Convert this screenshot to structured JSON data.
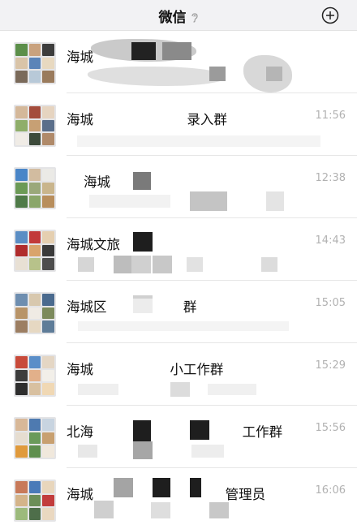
{
  "header": {
    "title": "微信",
    "muted_icon": "ear-icon",
    "add_icon": "plus-circle-icon"
  },
  "chats": [
    {
      "name": "海城",
      "time": ""
    },
    {
      "name": "海城                      录入群",
      "time": "11:56"
    },
    {
      "name": "    海城",
      "time": "12:38"
    },
    {
      "name": "海城文旅",
      "time": "14:43"
    },
    {
      "name": "海城区                  群",
      "time": "15:05"
    },
    {
      "name": "海城                  小工作群",
      "time": "15:29"
    },
    {
      "name": "北海                                   工作群",
      "time": "15:56"
    },
    {
      "name": "海城                               管理员",
      "time": "16:06"
    }
  ],
  "colors": {
    "header_bg": "#f2f2f4",
    "time_gray": "#b2b2b2",
    "divider": "#e6e6e6"
  }
}
